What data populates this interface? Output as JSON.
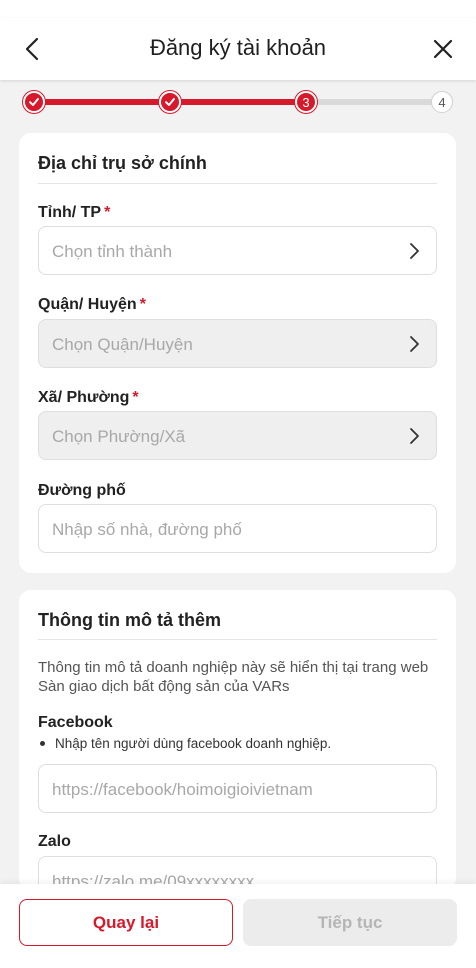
{
  "header": {
    "title": "Đăng ký tài khoản",
    "back_icon": "chevron-left-icon",
    "close_icon": "close-icon"
  },
  "stepper": {
    "steps": [
      {
        "state": "done",
        "label": ""
      },
      {
        "state": "done",
        "label": ""
      },
      {
        "state": "current",
        "label": "3"
      },
      {
        "state": "todo",
        "label": "4"
      }
    ],
    "accent": "#d6192b"
  },
  "address": {
    "title": "Địa chỉ trụ sở chính",
    "province": {
      "label": "Tỉnh/ TP",
      "required": "*",
      "placeholder": "Chọn tỉnh thành"
    },
    "district": {
      "label": "Quận/ Huyện",
      "required": "*",
      "placeholder": "Chọn Quận/Huyện"
    },
    "ward": {
      "label": "Xã/ Phường",
      "required": "*",
      "placeholder": "Chọn Phường/Xã"
    },
    "street": {
      "label": "Đường phố",
      "placeholder": "Nhập số nhà, đường phố"
    }
  },
  "extra": {
    "title": "Thông tin mô tả thêm",
    "description": "Thông tin mô tả doanh nghiệp này sẽ hiển thị tại trang web Sàn giao dịch bất động sản của VARs",
    "facebook": {
      "label": "Facebook",
      "hint": "Nhập tên người dùng facebook doanh nghiệp.",
      "placeholder": "https://facebook/hoimoigioivietnam"
    },
    "zalo": {
      "label": "Zalo",
      "placeholder": "https://zalo.me/09xxxxxxxx"
    }
  },
  "footer": {
    "back_label": "Quay lại",
    "next_label": "Tiếp tục"
  }
}
